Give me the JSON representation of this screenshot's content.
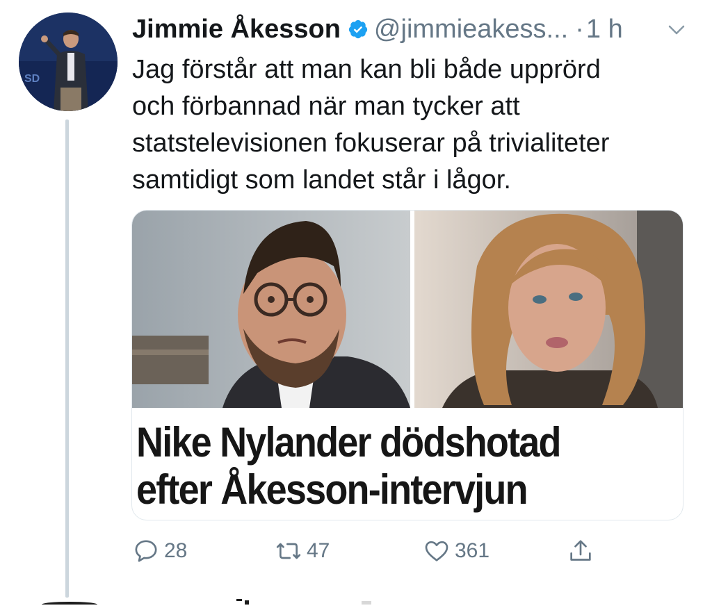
{
  "tweet": {
    "author_name": "Jimmie Åkesson",
    "verified": true,
    "handle": "@jimmieakess...",
    "separator": "·",
    "time": "1 h",
    "text_lines": [
      "Jag förstår att man kan bli både upprörd",
      "och förbannad när man tycker att",
      "statstelevisionen fokuserar på trivialiteter",
      "samtidigt som landet står i lågor."
    ],
    "media": {
      "headline_lines": [
        "Nike Nylander dödshotad",
        "efter Åkesson-intervjun"
      ],
      "avatar_badge": "SD"
    },
    "actions": {
      "reply_count": "28",
      "retweet_count": "47",
      "like_count": "361"
    }
  },
  "colors": {
    "verified_blue": "#1da1f2",
    "muted_text": "#657786",
    "thread_line": "#ccd6dd"
  },
  "icons": {
    "reply": "speech-bubble-icon",
    "retweet": "retweet-arrows-icon",
    "like": "heart-icon",
    "share": "share-upload-icon",
    "more": "chevron-down-icon",
    "verified": "verified-badge-icon"
  }
}
